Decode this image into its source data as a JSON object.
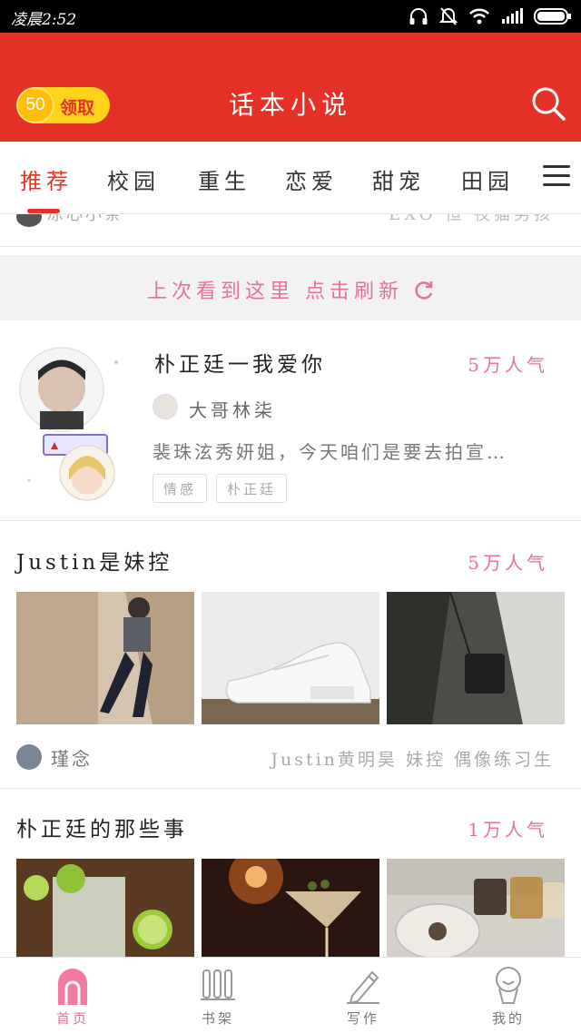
{
  "status_bar": {
    "time": "凌晨2:52"
  },
  "header": {
    "coin_count": "50",
    "coin_label": "领取",
    "title": "话本小说"
  },
  "categories": {
    "tabs": [
      "推荐",
      "校园",
      "重生",
      "恋爱",
      "甜宠",
      "田园"
    ],
    "active_index": 0
  },
  "prev_item": {
    "author": "凉心小条",
    "tags": "EXO 恒 夜猫男孩"
  },
  "refresh_banner": {
    "text": "上次看到这里 点击刷新"
  },
  "book_card": {
    "title": "朴正廷一我爱你",
    "popularity": "5万人气",
    "author": "大哥林柒",
    "description": "裴珠泫秀妍姐，今天咱们是要去拍宣…",
    "tags": [
      "情感",
      "朴正廷"
    ]
  },
  "collections": [
    {
      "title": "Justin是妹控",
      "popularity": "5万人气",
      "author": "瑾念",
      "tags": "Justin黄明昊 妹控 偶像练习生"
    },
    {
      "title": "朴正廷的那些事",
      "popularity": "1万人气"
    }
  ],
  "bottom_nav": {
    "items": [
      {
        "label": "首页",
        "icon": "home-icon"
      },
      {
        "label": "书架",
        "icon": "bookshelf-icon"
      },
      {
        "label": "写作",
        "icon": "pen-icon"
      },
      {
        "label": "我的",
        "icon": "profile-icon"
      }
    ],
    "active_index": 0
  },
  "colors": {
    "brand_red": "#e63128",
    "accent_pink": "#e8709a",
    "coin_yellow": "#ffd21c"
  }
}
